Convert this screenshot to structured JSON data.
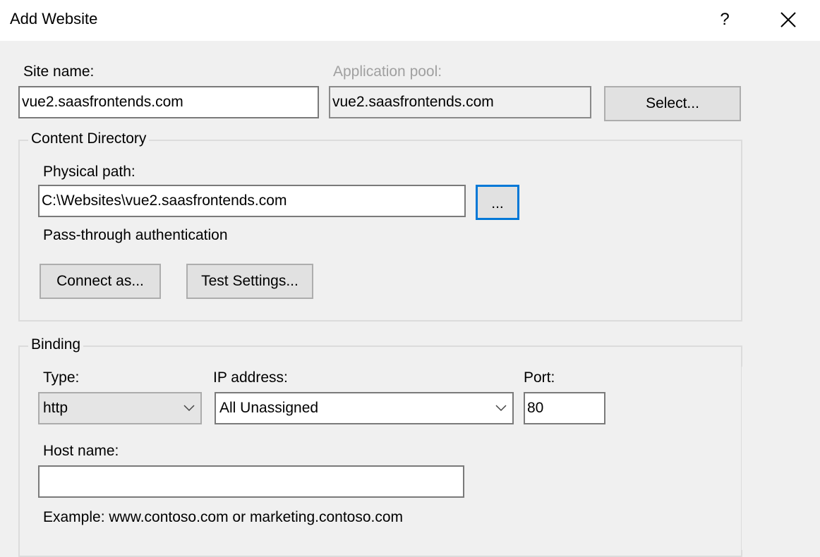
{
  "window": {
    "title": "Add Website",
    "help_label": "?",
    "close_icon": "close-icon"
  },
  "site": {
    "site_name_label": "Site name:",
    "site_name_value": "vue2.saasfrontends.com",
    "app_pool_label": "Application pool:",
    "app_pool_value": "vue2.saasfrontends.com",
    "select_button": "Select..."
  },
  "content_directory": {
    "group_title": "Content Directory",
    "physical_path_label": "Physical path:",
    "physical_path_value": "C:\\Websites\\vue2.saasfrontends.com",
    "browse_button": "...",
    "pass_through_label": "Pass-through authentication",
    "connect_as_button": "Connect as...",
    "test_settings_button": "Test Settings..."
  },
  "binding": {
    "group_title": "Binding",
    "type_label": "Type:",
    "type_value": "http",
    "ip_label": "IP address:",
    "ip_value": "All Unassigned",
    "port_label": "Port:",
    "port_value": "80",
    "host_name_label": "Host name:",
    "host_name_value": "",
    "example_text": "Example: www.contoso.com or marketing.contoso.com"
  },
  "colors": {
    "background": "#f0f0f0",
    "focus_accent": "#0078d7",
    "disabled_text": "#a0a0a0"
  }
}
